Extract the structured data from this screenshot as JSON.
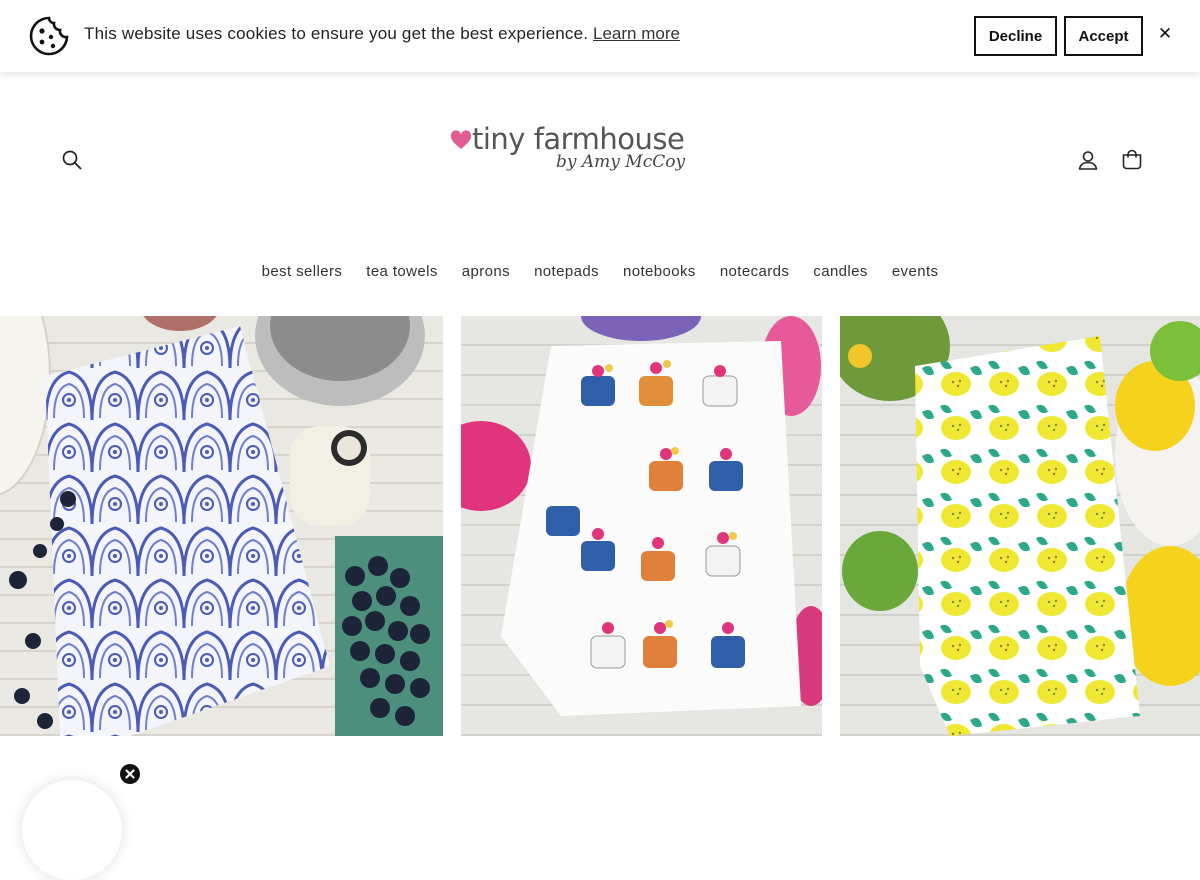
{
  "cookie_bar": {
    "message": "This website uses cookies to ensure you get the best experience.",
    "learn_more": "Learn more",
    "decline": "Decline",
    "accept": "Accept",
    "close": "✕"
  },
  "header": {
    "logo_main": "tiny farmhouse",
    "logo_sub": "by Amy McCoy",
    "icons": [
      "search-icon",
      "account-icon",
      "cart-icon"
    ]
  },
  "nav": {
    "items": [
      "best sellers",
      "tea towels",
      "aprons",
      "notepads",
      "notebooks",
      "notecards",
      "candles",
      "events"
    ]
  },
  "colors": {
    "brand_pink": "#e05c93",
    "text": "#222222"
  }
}
